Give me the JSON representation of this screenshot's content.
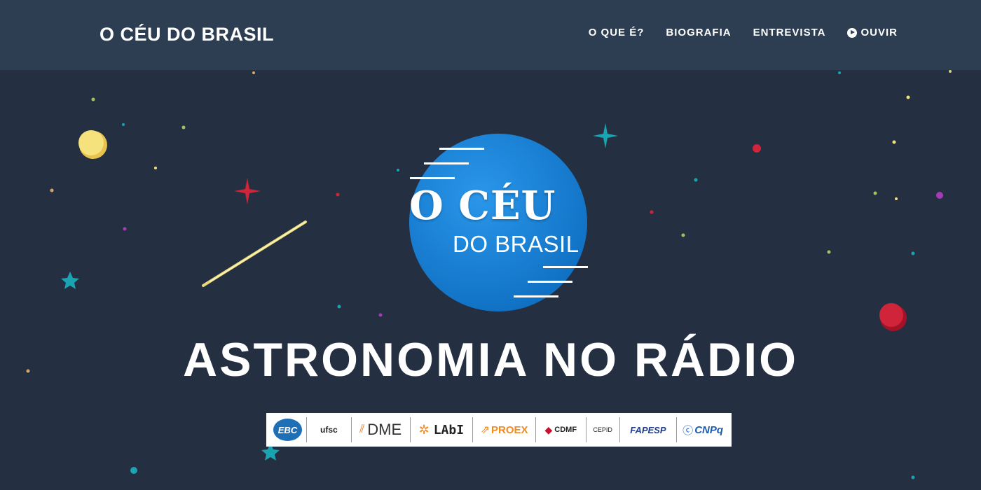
{
  "navbar": {
    "brand": "O CÉU DO BRASIL",
    "links": [
      {
        "label": "O QUE É?"
      },
      {
        "label": "BIOGRAFIA"
      },
      {
        "label": "ENTREVISTA"
      },
      {
        "label": "OUVIR",
        "icon": "play-circle-icon"
      }
    ]
  },
  "logo": {
    "title": "O CÉU",
    "subtitle": "DO BRASIL"
  },
  "headline": "ASTRONOMIA NO RÁDIO",
  "partners": [
    {
      "name": "EBC"
    },
    {
      "name": "ufsc"
    },
    {
      "name": "DME"
    },
    {
      "name": "LAbI"
    },
    {
      "name": "PROEX"
    },
    {
      "name": "CDMF"
    },
    {
      "name": "CEPID"
    },
    {
      "name": "FAPESP"
    },
    {
      "name": "CNPq"
    }
  ],
  "colors": {
    "background": "#243042",
    "navbar": "#2d3e52",
    "logo_circle": "#1a7fd4",
    "star_red": "#d0243a",
    "star_teal": "#1aa3b0",
    "planet_yellow": "#f2e07a"
  }
}
